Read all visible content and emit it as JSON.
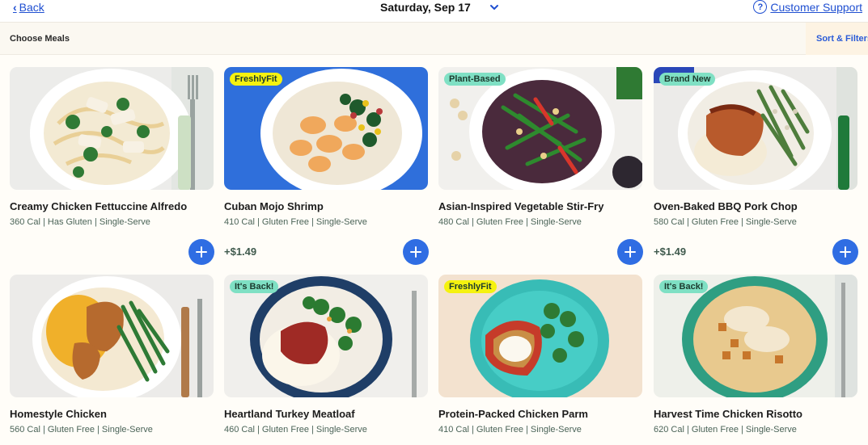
{
  "header": {
    "back_label": "Back",
    "date_title": "Saturday, Sep 17",
    "support_label": "Customer Support"
  },
  "subheader": {
    "title": "Choose Meals",
    "sort_label": "Sort & Filters"
  },
  "colors": {
    "accent": "#2f6de3",
    "link": "#1f4fd1",
    "badge_freshlyfit": "#f5f20f",
    "badge_teal": "#7fe0c4"
  },
  "meals": [
    {
      "name": "Creamy Chicken Fettuccine Alfredo",
      "meta": "360 Cal | Has Gluten | Single-Serve",
      "badge": "",
      "price": ""
    },
    {
      "name": "Cuban Mojo Shrimp",
      "meta": "410 Cal | Gluten Free | Single-Serve",
      "badge": "FreshlyFit",
      "price": "+$1.49"
    },
    {
      "name": "Asian-Inspired Vegetable Stir-Fry",
      "meta": "480 Cal | Gluten Free | Single-Serve",
      "badge": "Plant-Based",
      "price": ""
    },
    {
      "name": "Oven-Baked BBQ Pork Chop",
      "meta": "580 Cal | Gluten Free | Single-Serve",
      "badge": "Brand New",
      "price": "+$1.49"
    },
    {
      "name": "Homestyle Chicken",
      "meta": "560 Cal | Gluten Free | Single-Serve",
      "badge": "",
      "price": ""
    },
    {
      "name": "Heartland Turkey Meatloaf",
      "meta": "460 Cal | Gluten Free | Single-Serve",
      "badge": "It's Back!",
      "price": ""
    },
    {
      "name": "Protein-Packed Chicken Parm",
      "meta": "410 Cal | Gluten Free | Single-Serve",
      "badge": "FreshlyFit",
      "price": ""
    },
    {
      "name": "Harvest Time Chicken Risotto",
      "meta": "620 Cal | Gluten Free | Single-Serve",
      "badge": "It's Back!",
      "price": ""
    }
  ]
}
